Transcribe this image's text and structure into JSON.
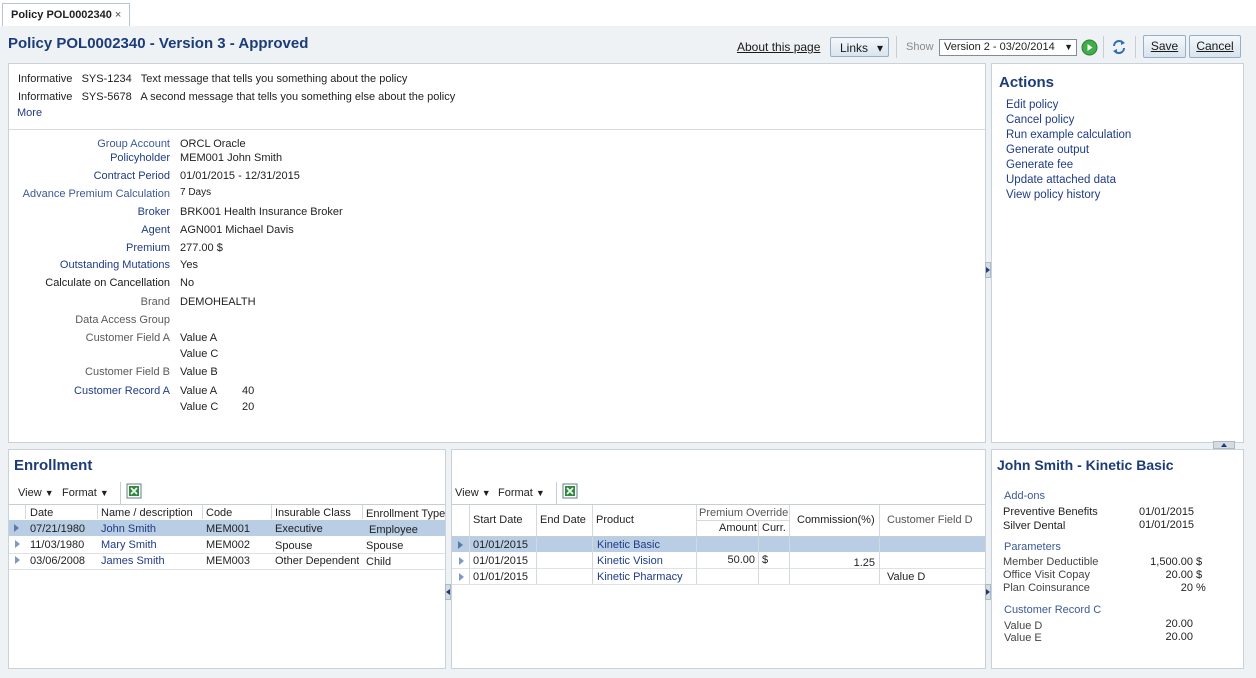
{
  "tab": {
    "label": "Policy POL0002340",
    "close": "×"
  },
  "page": {
    "title": "Policy  POL0002340 - Version 3 - Approved",
    "about_link": "About this page",
    "links_label": "Links",
    "show_label": "Show",
    "version_select": "Version 2 - 03/20/2014",
    "save_label": "Save",
    "cancel_label": "Cancel"
  },
  "messages": [
    {
      "level": "Informative",
      "code": "SYS-1234",
      "text": "Text message that tells you something about the policy"
    },
    {
      "level": "Informative",
      "code": "SYS-5678",
      "text": "A second message that tells you something else about the policy"
    }
  ],
  "more_label": "More",
  "fields": {
    "group_account": {
      "label": "Group Account",
      "value": "ORCL Oracle"
    },
    "policyholder": {
      "label": "Policyholder",
      "value": "MEM001 John Smith"
    },
    "contract_period": {
      "label": "Contract Period",
      "value": "01/01/2015 - 12/31/2015"
    },
    "advance_premium": {
      "label": "Advance Premium Calculation",
      "value": "7 Days"
    },
    "broker": {
      "label": "Broker",
      "value": "BRK001 Health Insurance Broker"
    },
    "agent": {
      "label": "Agent",
      "value": "AGN001 Michael Davis"
    },
    "premium": {
      "label": "Premium",
      "value": "277.00",
      "currency": "$"
    },
    "outstanding": {
      "label": "Outstanding Mutations",
      "value": "Yes"
    },
    "calc_cancel": {
      "label": "Calculate on Cancellation",
      "value": "No"
    },
    "brand": {
      "label": "Brand",
      "value": "DEMOHEALTH"
    },
    "data_access": {
      "label": "Data Access Group",
      "value": ""
    },
    "custA": {
      "label": "Customer Field A",
      "values": [
        "Value A",
        "Value C"
      ]
    },
    "custB": {
      "label": "Customer Field B",
      "value": "Value B"
    },
    "recA": {
      "label": "Customer Record A",
      "rows": [
        {
          "k": "Value A",
          "v": "40"
        },
        {
          "k": "Value C",
          "v": "20"
        }
      ]
    }
  },
  "actions": {
    "title": "Actions",
    "items": [
      "Edit policy",
      "Cancel policy",
      "Run example calculation",
      "Generate output",
      "Generate fee",
      "Update attached data",
      "View policy history"
    ]
  },
  "enrollment": {
    "title": "Enrollment",
    "view_label": "View",
    "format_label": "Format",
    "columns": [
      "Date",
      "Name / description",
      "Code",
      "Insurable Class",
      "Enrollment Type"
    ],
    "rows": [
      {
        "date": "07/21/1980",
        "name": "John Smith",
        "code": "MEM001",
        "class": "Executive",
        "type": "Employee"
      },
      {
        "date": "11/03/1980",
        "name": "Mary Smith",
        "code": "MEM002",
        "class": "Spouse",
        "type": "Spouse"
      },
      {
        "date": "03/06/2008",
        "name": "James Smith",
        "code": "MEM003",
        "class": "Other Dependent",
        "type": "Child"
      }
    ]
  },
  "products": {
    "view_label": "View",
    "format_label": "Format",
    "columns": {
      "start": "Start Date",
      "end": "End Date",
      "product": "Product",
      "override": "Premium Override",
      "amount": "Amount",
      "curr": "Curr.",
      "commission": "Commission(%)",
      "custD": "Customer Field D"
    },
    "rows": [
      {
        "start": "01/01/2015",
        "end": "",
        "product": "Kinetic Basic",
        "amount": "",
        "curr": "",
        "commission": "",
        "custD": ""
      },
      {
        "start": "01/01/2015",
        "end": "",
        "product": "Kinetic Vision",
        "amount": "50.00",
        "curr": "$",
        "commission": "1.25",
        "custD": ""
      },
      {
        "start": "01/01/2015",
        "end": "",
        "product": "Kinetic Pharmacy",
        "amount": "",
        "curr": "",
        "commission": "",
        "custD": "Value D"
      }
    ]
  },
  "detail": {
    "title": "John Smith - Kinetic Basic",
    "addons_label": "Add-ons",
    "addons": [
      {
        "name": "Preventive Benefits",
        "date": "01/01/2015"
      },
      {
        "name": "Silver Dental",
        "date": "01/01/2015"
      }
    ],
    "params_label": "Parameters",
    "params": [
      {
        "name": "Member Deductible",
        "value": "1,500.00",
        "unit": "$"
      },
      {
        "name": "Office Visit Copay",
        "value": "20.00",
        "unit": "$"
      },
      {
        "name": "Plan Coinsurance",
        "value": "20",
        "unit": "%"
      }
    ],
    "recC_label": "Customer Record C",
    "recC": [
      {
        "name": "Value D",
        "value": "20.00"
      },
      {
        "name": "Value E",
        "value": "20.00"
      }
    ]
  }
}
